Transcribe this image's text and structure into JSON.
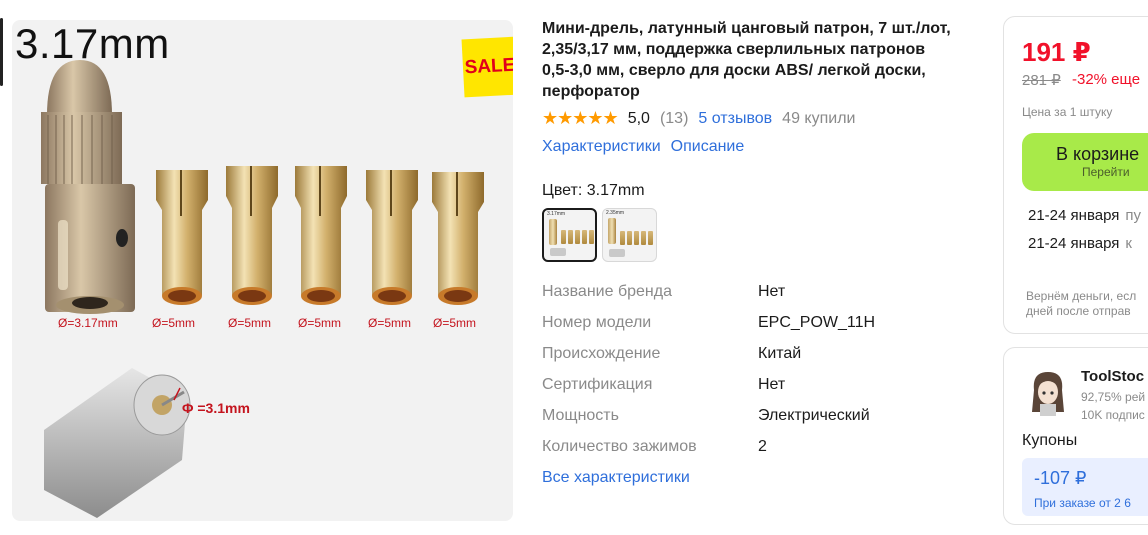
{
  "gallery": {
    "overlay_label": "3.17mm",
    "sale_badge": "SALE",
    "collet_labels": [
      "Ø=3.17mm",
      "Ø=5mm",
      "Ø=5mm",
      "Ø=5mm",
      "Ø=5mm",
      "Ø=5mm"
    ],
    "motor_label": "Φ =3.1mm"
  },
  "product": {
    "title": "Мини-дрель, латунный цанговый патрон, 7 шт./лот, 2,35/3,17 мм, поддержка сверлильных патронов 0,5-3,0 мм, сверло для доски ABS/ легкой доски, перфоратор",
    "stars": "★★★★★",
    "rating": "5,0",
    "rating_count": "(13)",
    "reviews_link": "5 отзывов",
    "bought": "49 купили",
    "tabs": [
      "Характеристики",
      "Описание"
    ],
    "color_label": "Цвет: 3.17mm",
    "swatch_captions": [
      "3.17mm",
      "2.35mm"
    ],
    "specs": [
      {
        "name": "Название бренда",
        "value": "Нет"
      },
      {
        "name": "Номер модели",
        "value": "EPC_POW_11H"
      },
      {
        "name": "Происхождение",
        "value": "Китай"
      },
      {
        "name": "Сертификация",
        "value": "Нет"
      },
      {
        "name": "Мощность",
        "value": "Электрический"
      },
      {
        "name": "Количество зажимов",
        "value": "2"
      }
    ],
    "all_specs_link": "Все характеристики"
  },
  "price_card": {
    "price": "191 ₽",
    "old_price": "281 ₽",
    "discount": "-32% еще",
    "unit_price": "Цена за 1 штуку",
    "cart_button": "В корзине",
    "cart_sub": "Перейти",
    "delivery": [
      {
        "date": "21-24 января",
        "service": "пу"
      },
      {
        "date": "21-24 января",
        "service": "к"
      }
    ],
    "guarantee_l1": "Вернём деньги, есл",
    "guarantee_l2": "дней после отправ"
  },
  "seller": {
    "name": "ToolStoc",
    "rating": "92,75% рей",
    "subscribers": "10K подпис",
    "coupons_label": "Купоны",
    "coupon_value": "-107 ₽",
    "coupon_condition": "При заказе от 2 6"
  },
  "colors": {
    "accent_blue": "#2f6fdb",
    "price_red": "#f1112a",
    "cart_green": "#a8ea49",
    "star_orange": "#ff9a00",
    "sale_yellow": "#ffe600"
  }
}
